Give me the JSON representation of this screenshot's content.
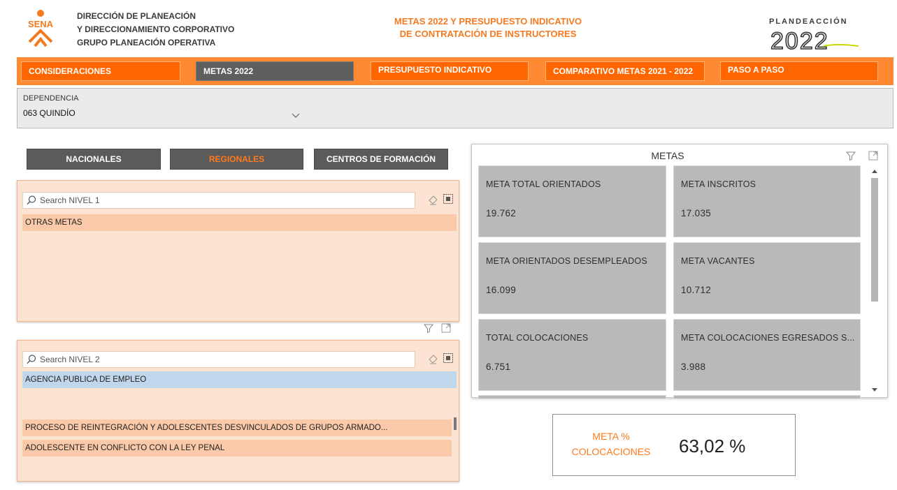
{
  "header": {
    "org_lines": [
      "DIRECCIÓN DE PLANEACIÓN",
      "Y DIRECCIONAMIENTO CORPORATIVO",
      "GRUPO PLANEACIÓN OPERATIVA"
    ],
    "title_lines": [
      "METAS 2022 Y PRESUPUESTO INDICATIVO",
      "DE CONTRATACIÓN DE INSTRUCTORES"
    ],
    "sena_logo_text": "SENA",
    "plan_logo_text": "PLANDEACCIÓN",
    "plan_year_text": "2022"
  },
  "nav": {
    "tabs": [
      {
        "label": "CONSIDERACIONES",
        "state": "orange"
      },
      {
        "label": "METAS 2022",
        "state": "dark"
      },
      {
        "label": "PRESUPUESTO INDICATIVO",
        "state": "orange"
      },
      {
        "label": "COMPARATIVO METAS 2021 - 2022",
        "state": "orange"
      },
      {
        "label": "PASO A PASO",
        "state": "orange"
      }
    ]
  },
  "dependencia": {
    "label": "DEPENDENCIA",
    "selected": "063 QUINDÍO"
  },
  "level_buttons": [
    {
      "label": "NACIONALES",
      "active": false
    },
    {
      "label": "REGIONALES",
      "active": true
    },
    {
      "label": "CENTROS DE FORMACIÓN",
      "active": false
    }
  ],
  "nivel1": {
    "placeholder": "Search NIVEL 1",
    "items": [
      "OTRAS METAS"
    ]
  },
  "nivel2": {
    "placeholder": "Search NIVEL 2",
    "items": [
      "AGENCIA PUBLICA DE EMPLEO",
      "PROCESO DE REINTEGRACIÓN Y ADOLESCENTES DESVINCULADOS DE GRUPOS ARMADO...",
      "ADOLESCENTE EN CONFLICTO CON LA LEY PENAL"
    ]
  },
  "metas": {
    "title": "METAS",
    "cards": [
      {
        "label": "META TOTAL ORIENTADOS",
        "value": "19.762"
      },
      {
        "label": "META INSCRITOS",
        "value": "17.035"
      },
      {
        "label": "META ORIENTADOS DESEMPLEADOS",
        "value": "16.099"
      },
      {
        "label": "META VACANTES",
        "value": "10.712"
      },
      {
        "label": "TOTAL COLOCACIONES",
        "value": "6.751"
      },
      {
        "label": "META COLOCACIONES EGRESADOS S...",
        "value": "3.988"
      }
    ]
  },
  "kpi": {
    "label_lines": [
      "META %",
      "COLOCACIONES"
    ],
    "value": "63,02 %"
  },
  "colors": {
    "accent_orange": "#f47a20",
    "tab_orange": "#ff6600",
    "nav_bg": "#ff8a33",
    "tab_dark": "#5e5e5e",
    "card_gray": "#b9b9b9",
    "slicer_bg": "#fde3d1",
    "selected_blue": "#bfd6ec"
  }
}
